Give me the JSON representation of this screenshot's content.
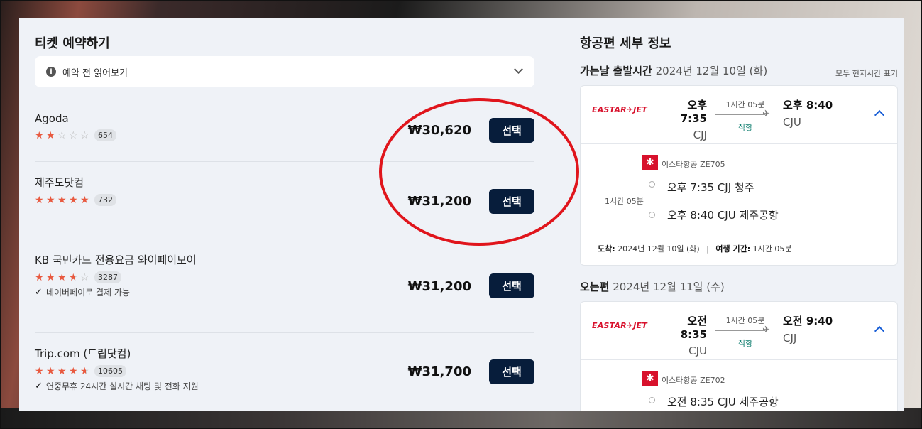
{
  "booking": {
    "title": "티켓 예약하기",
    "notice": "예약 전 읽어보기",
    "select_label": "선택",
    "vendors": [
      {
        "name": "Agoda",
        "rating": 2,
        "reviews": "654",
        "price": "₩30,620",
        "perk": ""
      },
      {
        "name": "제주도닷컴",
        "rating": 5,
        "reviews": "732",
        "price": "₩31,200",
        "perk": ""
      },
      {
        "name": "KB 국민카드 전용요금 와이페이모어",
        "rating": 3.5,
        "reviews": "3287",
        "price": "₩31,200",
        "perk": "네이버페이로 결제 가능"
      },
      {
        "name": "Trip.com (트립닷컴)",
        "rating": 4.5,
        "reviews": "10605",
        "price": "₩31,700",
        "perk": "연중무휴 24시간 실시간 채팅 및 전화 지원"
      }
    ]
  },
  "flight": {
    "title": "항공편 세부 정보",
    "timezone_note": "모두 현지시간 표기",
    "outbound": {
      "head_strong": "가는날 출발시간",
      "head_date": "2024년 12월 10일 (화)",
      "logo": "EASTAR✈JET",
      "dep_time": "오후 7:35",
      "dep_code": "CJJ",
      "arr_time": "오후 8:40",
      "arr_code": "CJU",
      "duration": "1시간 05분",
      "direct": "직항",
      "airline": "이스타항공 ZE705",
      "seg_duration": "1시간 05분",
      "stop1": "오후 7:35 CJJ 청주",
      "stop2": "오후 8:40 CJU 제주공항",
      "arrival_label": "도착:",
      "arrival_value": "2024년 12월 10일 (화)",
      "travel_label": "여행 기간:",
      "travel_value": "1시간 05분"
    },
    "return": {
      "head_strong": "오는편",
      "head_date": "2024년 12월 11일 (수)",
      "logo": "EASTAR✈JET",
      "dep_time": "오전 8:35",
      "dep_code": "CJU",
      "arr_time": "오전 9:40",
      "arr_code": "CJJ",
      "duration": "1시간 05분",
      "direct": "직항",
      "airline": "이스타항공 ZE702",
      "stop1": "오전 8:35 CJU 제주공항"
    }
  },
  "colors": {
    "accent_button": "#071d3b",
    "star": "#e8593f",
    "annotation_circle": "#e0151c",
    "direct": "#0d7d6e"
  }
}
